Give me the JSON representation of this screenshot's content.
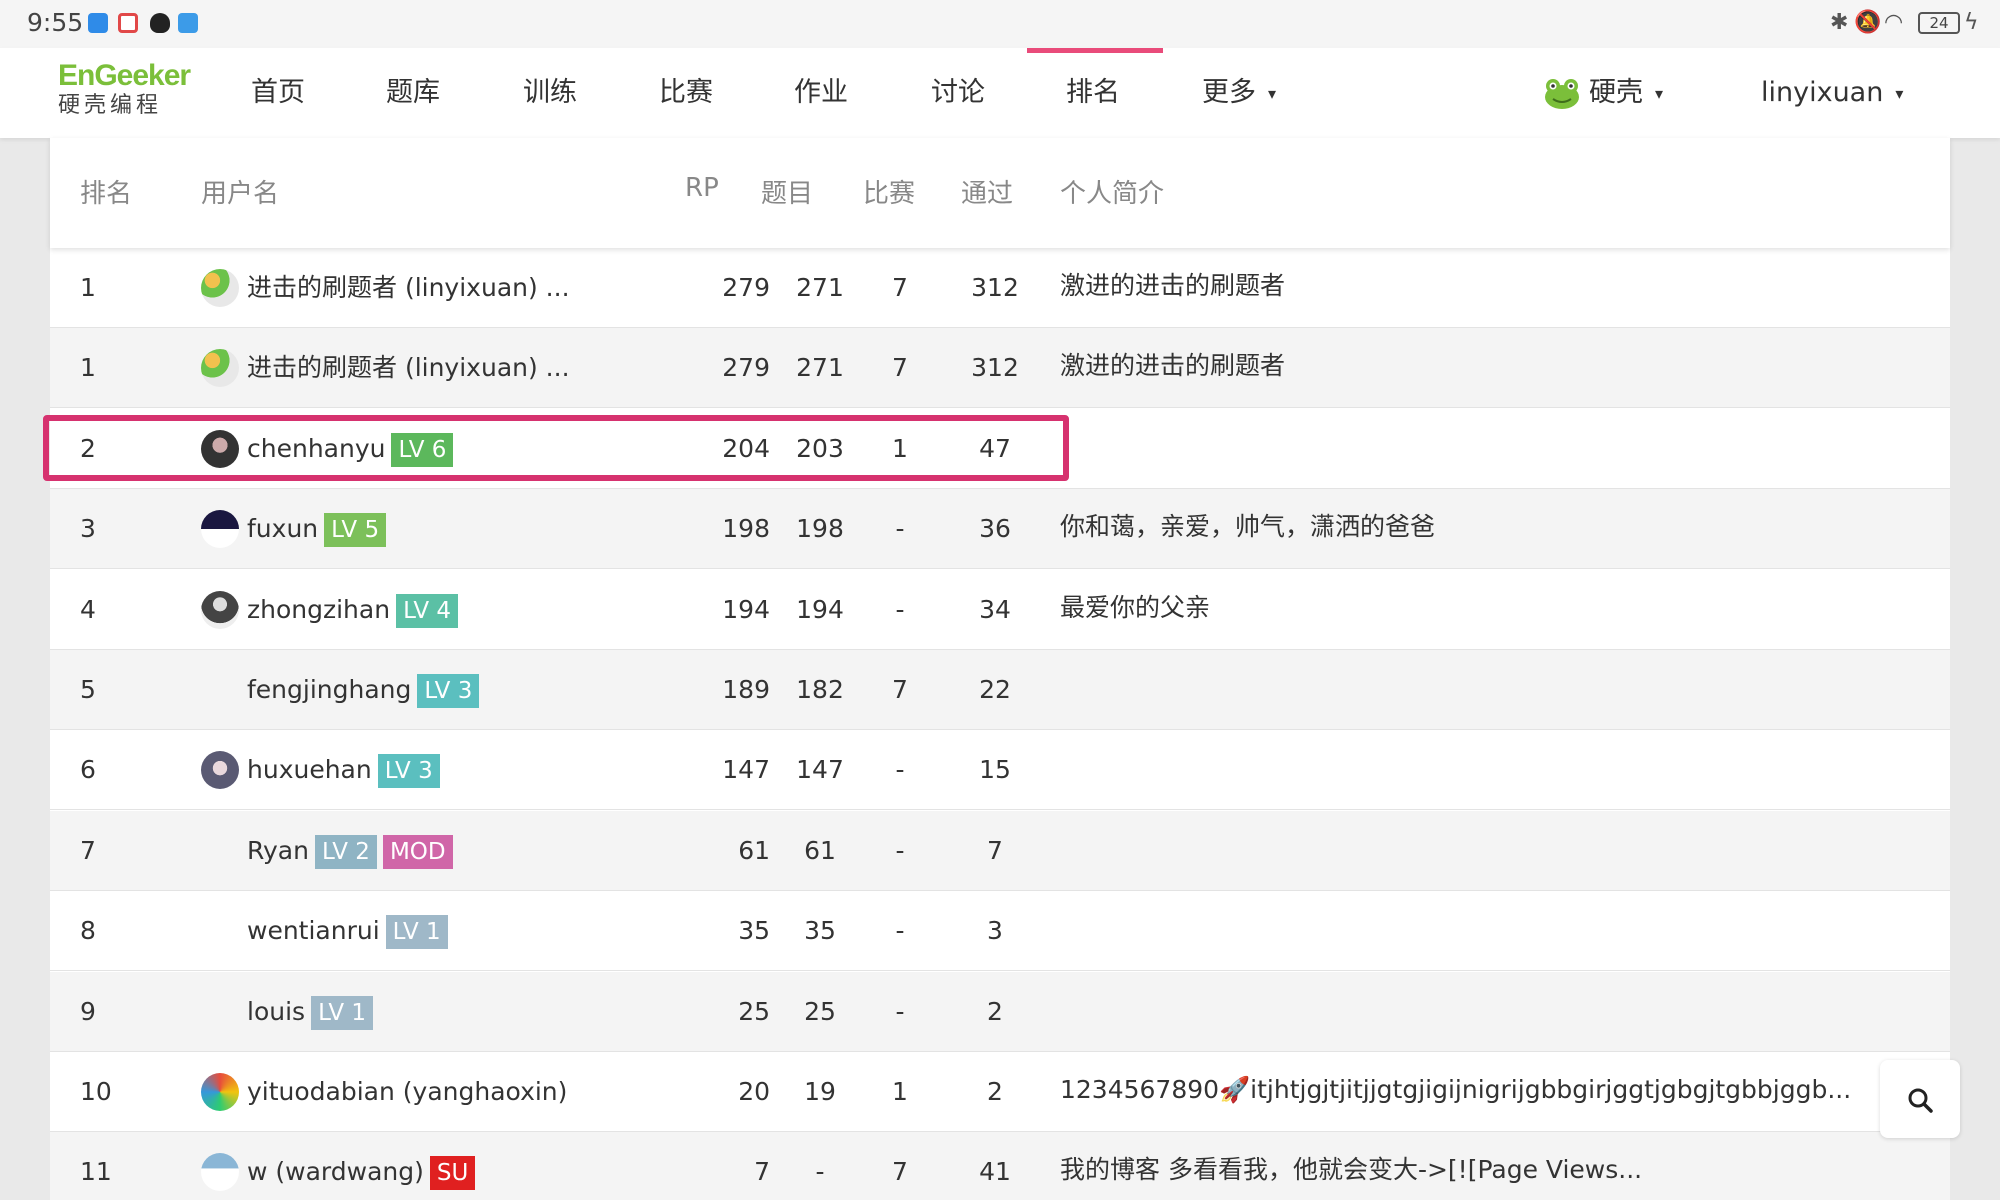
{
  "status_bar": {
    "time": "9:55",
    "battery": "24"
  },
  "brand": {
    "logo_en": "EnGeeker",
    "logo_cn": "硬壳编程"
  },
  "nav": {
    "items": [
      "首页",
      "题库",
      "训练",
      "比赛",
      "作业",
      "讨论",
      "排名",
      "更多"
    ],
    "active": "排名",
    "org": "硬壳",
    "user": "linyixuan",
    "accent_color": "#e94b7a"
  },
  "table": {
    "headers": {
      "rank": "排名",
      "username": "用户名",
      "rp": "RP",
      "problems": "题目",
      "contests": "比赛",
      "passed": "通过",
      "bio": "个人简介"
    },
    "rows": [
      {
        "rank": "1",
        "name": "进击的刷题者 (linyixuan) ...",
        "badges": [],
        "rp": "279",
        "problems": "271",
        "contests": "7",
        "passed": "312",
        "bio": "激进的进击的刷题者",
        "avatar": "flower"
      },
      {
        "rank": "1",
        "name": "进击的刷题者 (linyixuan) ...",
        "badges": [],
        "rp": "279",
        "problems": "271",
        "contests": "7",
        "passed": "312",
        "bio": "激进的进击的刷题者",
        "avatar": "flower"
      },
      {
        "rank": "2",
        "name": "chenhanyu",
        "badges": [
          {
            "text": "LV 6",
            "color": "#5cb85c"
          }
        ],
        "rp": "204",
        "problems": "203",
        "contests": "1",
        "passed": "47",
        "bio": "",
        "avatar": "dark"
      },
      {
        "rank": "3",
        "name": "fuxun",
        "badges": [
          {
            "text": "LV 5",
            "color": "#7cc05a"
          }
        ],
        "rp": "198",
        "problems": "198",
        "contests": "-",
        "passed": "36",
        "bio": "你和蔼，亲爱，帅气，潇洒的爸爸",
        "avatar": "half"
      },
      {
        "rank": "4",
        "name": "zhongzihan",
        "badges": [
          {
            "text": "LV 4",
            "color": "#5bc0a5"
          }
        ],
        "rp": "194",
        "problems": "194",
        "contests": "-",
        "passed": "34",
        "bio": "最爱你的父亲",
        "avatar": "figure"
      },
      {
        "rank": "5",
        "name": "fengjinghang",
        "badges": [
          {
            "text": "LV 3",
            "color": "#5bbfbf"
          }
        ],
        "rp": "189",
        "problems": "182",
        "contests": "7",
        "passed": "22",
        "bio": "",
        "avatar": "none"
      },
      {
        "rank": "6",
        "name": "huxuehan",
        "badges": [
          {
            "text": "LV 3",
            "color": "#5bbfbf"
          }
        ],
        "rp": "147",
        "problems": "147",
        "contests": "-",
        "passed": "15",
        "bio": "",
        "avatar": "anime"
      },
      {
        "rank": "7",
        "name": "Ryan",
        "badges": [
          {
            "text": "LV 2",
            "color": "#8fb4c4"
          },
          {
            "text": "MOD",
            "color": "#d066a8"
          }
        ],
        "rp": "61",
        "problems": "61",
        "contests": "-",
        "passed": "7",
        "bio": "",
        "avatar": "none"
      },
      {
        "rank": "8",
        "name": "wentianrui",
        "badges": [
          {
            "text": "LV 1",
            "color": "#9fb8c8"
          }
        ],
        "rp": "35",
        "problems": "35",
        "contests": "-",
        "passed": "3",
        "bio": "",
        "avatar": "none"
      },
      {
        "rank": "9",
        "name": "louis",
        "badges": [
          {
            "text": "LV 1",
            "color": "#9fb8c8"
          }
        ],
        "rp": "25",
        "problems": "25",
        "contests": "-",
        "passed": "2",
        "bio": "",
        "avatar": "none"
      },
      {
        "rank": "10",
        "name": "yituodabian (yanghaoxin)",
        "badges": [],
        "rp": "20",
        "problems": "19",
        "contests": "1",
        "passed": "2",
        "bio": "1234567890🚀itjhtjgjtjitjjgtgjigijnigrijgbbgirjggtjgbgjtgbbjggb...",
        "avatar": "colorful"
      },
      {
        "rank": "11",
        "name": "w (wardwang)",
        "badges": [
          {
            "text": "SU",
            "color": "#e02020"
          }
        ],
        "rp": "7",
        "problems": "-",
        "contests": "7",
        "passed": "41",
        "bio": "我的博客 多看看我，他就会变大->[![Page Views...",
        "avatar": "sky"
      }
    ]
  },
  "highlight_color": "#d6326f"
}
